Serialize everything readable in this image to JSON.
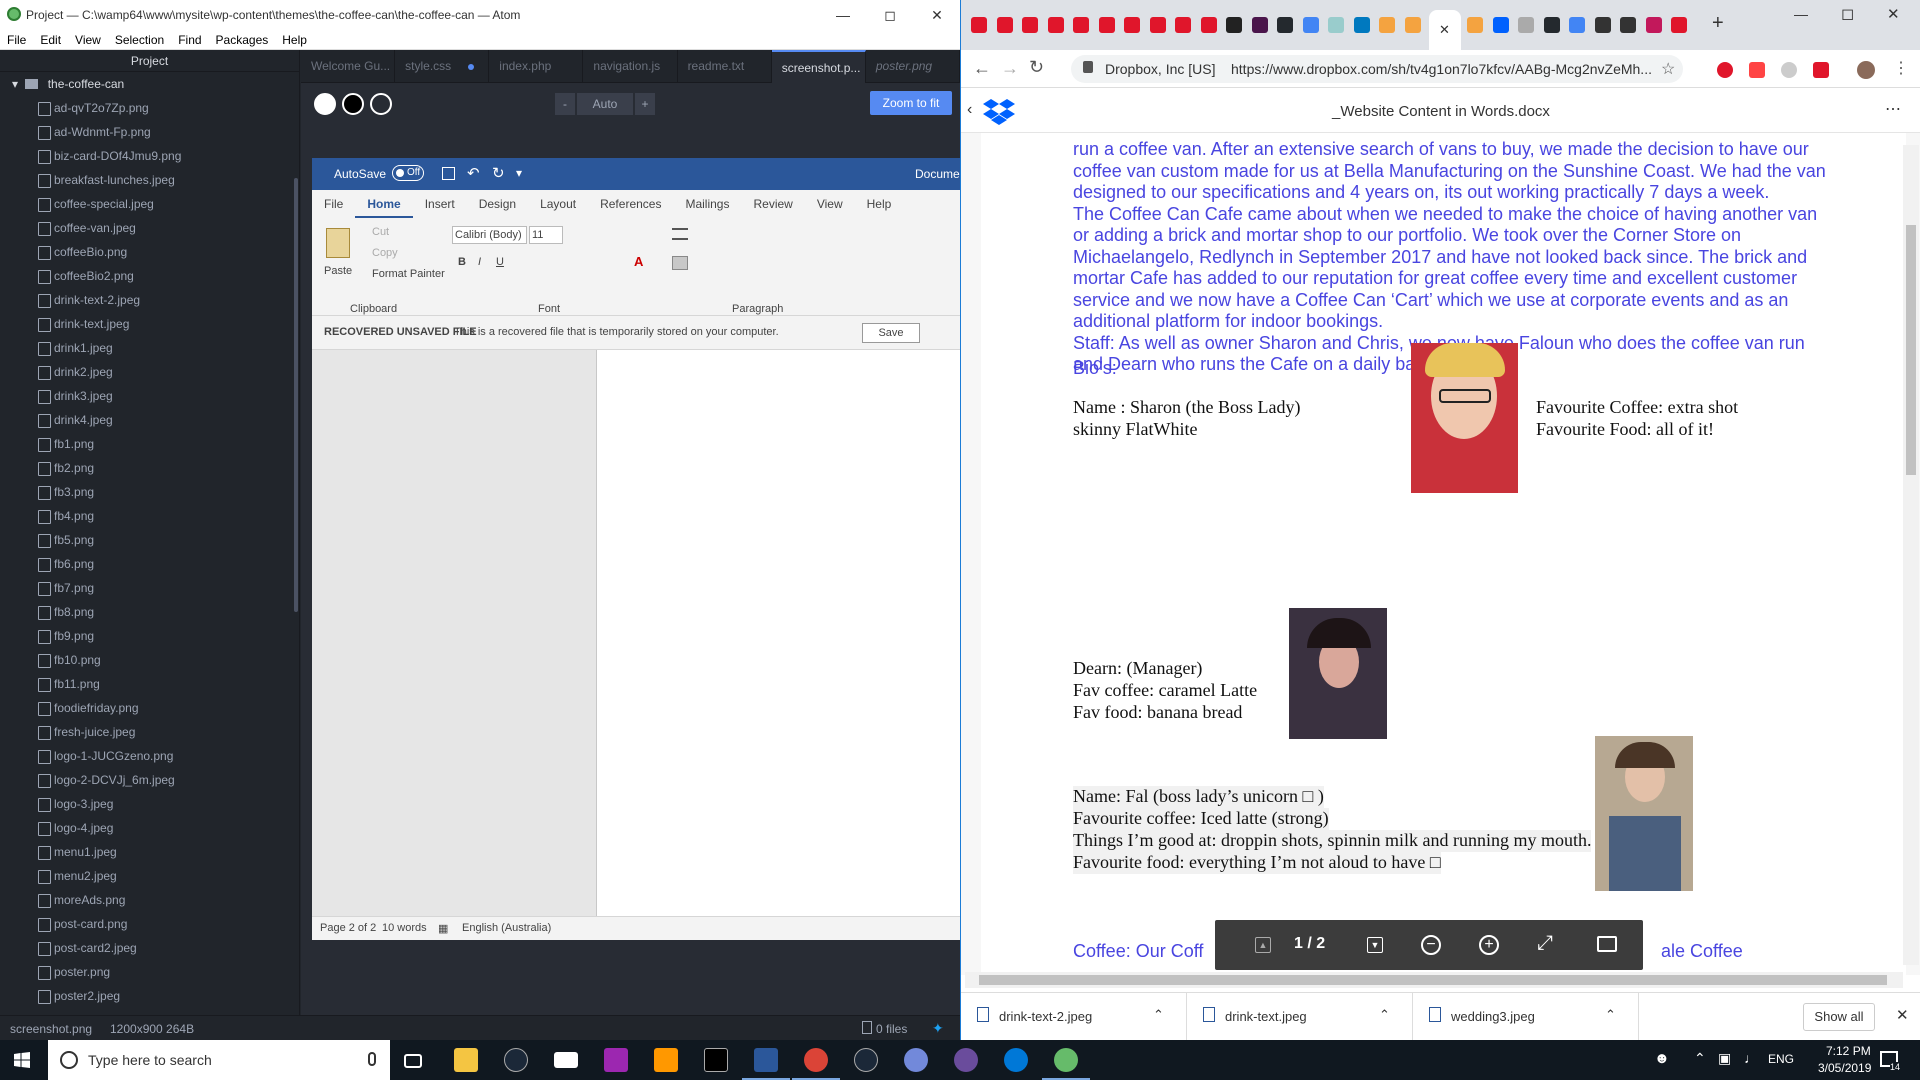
{
  "atom": {
    "title": "Project — C:\\wamp64\\www\\mysite\\wp-content\\themes\\the-coffee-can\\the-coffee-can — Atom",
    "menu": [
      "File",
      "Edit",
      "View",
      "Selection",
      "Find",
      "Packages",
      "Help"
    ],
    "project_label": "Project",
    "root_folder": "the-coffee-can",
    "files": [
      "ad-qvT2o7Zp.png",
      "ad-Wdnmt-Fp.png",
      "biz-card-DOf4Jmu9.png",
      "breakfast-lunches.jpeg",
      "coffee-special.jpeg",
      "coffee-van.jpeg",
      "coffeeBio.png",
      "coffeeBio2.png",
      "drink-text-2.jpeg",
      "drink-text.jpeg",
      "drink1.jpeg",
      "drink2.jpeg",
      "drink3.jpeg",
      "drink4.jpeg",
      "fb1.png",
      "fb2.png",
      "fb3.png",
      "fb4.png",
      "fb5.png",
      "fb6.png",
      "fb7.png",
      "fb8.png",
      "fb9.png",
      "fb10.png",
      "fb11.png",
      "foodiefriday.png",
      "fresh-juice.jpeg",
      "logo-1-JUCGzeno.png",
      "logo-2-DCVJj_6m.jpeg",
      "logo-3.jpeg",
      "logo-4.jpeg",
      "menu1.jpeg",
      "menu2.jpeg",
      "moreAds.png",
      "post-card.png",
      "post-card2.jpeg",
      "poster.png",
      "poster2.jpeg"
    ],
    "tabs": [
      "Welcome Gu...",
      "style.css",
      "index.php",
      "navigation.js",
      "readme.txt",
      "screenshot.p...",
      "poster.png"
    ],
    "zoom_minus": "-",
    "zoom_value": "Auto",
    "zoom_plus": "+",
    "zoom_fit": "Zoom to fit",
    "status_file": "screenshot.png",
    "status_dims": "1200x900 264B",
    "status_files": "0 files"
  },
  "word": {
    "autosave": "AutoSave",
    "autosave_state": "Off",
    "doc_title": "Docume",
    "tabs": [
      "File",
      "Home",
      "Insert",
      "Design",
      "Layout",
      "References",
      "Mailings",
      "Review",
      "View",
      "Help"
    ],
    "paste": "Paste",
    "cut": "Cut",
    "copy": "Copy",
    "format_painter": "Format Painter",
    "clipboard": "Clipboard",
    "font_name": "Calibri (Body)",
    "font_size": "11",
    "font_group": "Font",
    "paragraph_group": "Paragraph",
    "recover_label": "RECOVERED UNSAVED FILE",
    "recover_text": "This is a recovered file that is temporarily stored on your computer.",
    "save": "Save",
    "status_page": "Page 2 of 2",
    "status_words": "10 words",
    "status_lang": "English (Australia)"
  },
  "chrome": {
    "site_info": "Dropbox, Inc [US]",
    "url": "https://www.dropbox.com/sh/tv4g1on7lo7kfcv/AABg-Mcg2nvZeMh...",
    "doc_title": "_Website Content in Words.docx",
    "paragraphs": [
      "run a coffee van.  After an extensive search of vans to buy, we made the decision to have our coffee van custom made for us at Bella Manufacturing on the Sunshine Coast.  We had the van designed to our specifications and 4 years on, its out working practically 7 days a week.",
      "  The Coffee Can Cafe came about when we needed to make the choice of having another van or adding a brick and mortar shop to our portfolio.  We took over the Corner Store on Michaelangelo, Redlynch in September 2017 and have not looked back since.  The brick and mortar Cafe has added to our reputation for great coffee every time and excellent customer service and we now have a Coffee Can ‘Cart’ which we use at corporate events and as an additional platform for indoor bookings.",
      "Staff:  As well as owner Sharon and Chris, we now have Faloun who does the coffee van run and Dearn who runs the Cafe on a daily basis."
    ],
    "bios_heading": "Bio’s:",
    "sharon": [
      "Name : Sharon (the Boss Lady)",
      "skinny FlatWhite"
    ],
    "sharon_fav": [
      "Favourite Coffee: extra shot",
      "Favourite Food: all of it!"
    ],
    "dearn": [
      "Dearn: (Manager)",
      "Fav coffee: caramel Latte",
      "Fav food: banana bread"
    ],
    "fal": [
      "Name: Fal (boss lady’s unicorn □ )",
      "Favourite coffee: Iced latte (strong)",
      "Things I’m good at: droppin shots, spinnin milk and running my mouth.",
      "Favourite food: everything I’m not aloud to have □"
    ],
    "coffee_line": "Coffee:  Our Coff",
    "coffee_line_end": "ale Coffee",
    "page_indicator": "1 / 2",
    "downloads": [
      "drink-text-2.jpeg",
      "drink-text.jpeg",
      "wedding3.jpeg"
    ],
    "show_all": "Show all"
  },
  "taskbar": {
    "search_placeholder": "Type here to search",
    "lang": "ENG",
    "time": "7:12 PM",
    "date": "3/05/2019",
    "notif_count": "14"
  },
  "colors": {
    "atom_bg": "#21252b",
    "atom_accent": "#568af2",
    "word_blue": "#2b579a",
    "doc_text": "#4945e0",
    "taskbar": "#101820"
  }
}
